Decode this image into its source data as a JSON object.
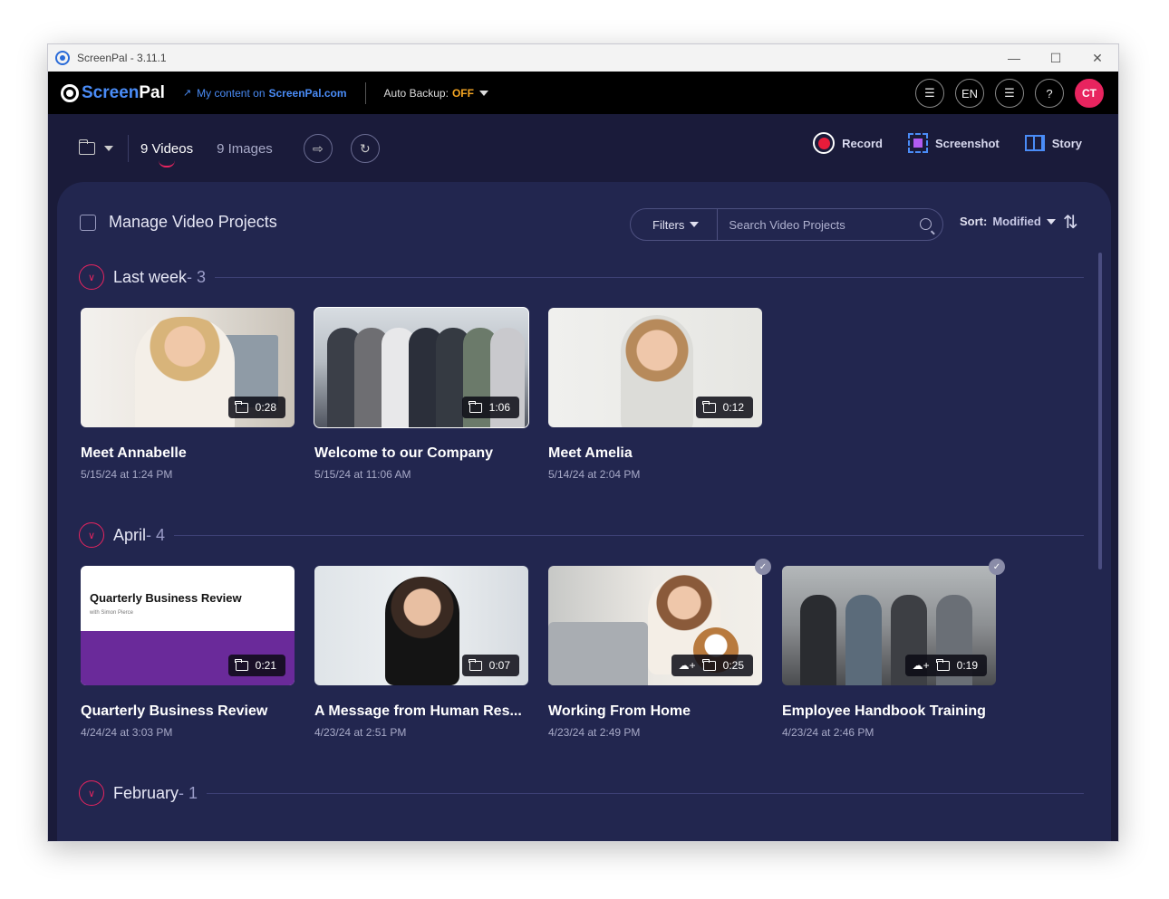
{
  "window": {
    "title": "ScreenPal - 3.11.1"
  },
  "topbar": {
    "logo_screen": "Screen",
    "logo_pal": "Pal",
    "my_content_prefix": "My content on",
    "my_content_site": "ScreenPal.com",
    "auto_backup_label": "Auto Backup:",
    "auto_backup_value": "OFF",
    "language": "EN",
    "avatar_initials": "CT"
  },
  "toolbar": {
    "tabs": [
      {
        "label": "9 Videos",
        "active": true
      },
      {
        "label": "9 Images",
        "active": false
      }
    ],
    "actions": {
      "record": "Record",
      "screenshot": "Screenshot",
      "story": "Story"
    }
  },
  "panel": {
    "manage_label": "Manage Video Projects",
    "filters_label": "Filters",
    "search_placeholder": "Search Video Projects",
    "sort_label": "Sort:",
    "sort_value": "Modified"
  },
  "sections": [
    {
      "title": "Last week",
      "count": " - 3",
      "videos": [
        {
          "title": "Meet Annabelle",
          "date": "5/15/24 at 1:24 PM",
          "duration": "0:28",
          "cloud": false,
          "checked": false
        },
        {
          "title": "Welcome to our Company",
          "date": "5/15/24 at 11:06 AM",
          "duration": "1:06",
          "cloud": false,
          "checked": false
        },
        {
          "title": "Meet Amelia",
          "date": "5/14/24 at 2:04 PM",
          "duration": "0:12",
          "cloud": false,
          "checked": false
        }
      ]
    },
    {
      "title": "April",
      "count": " - 4",
      "videos": [
        {
          "title": "Quarterly Business Review",
          "date": "4/24/24 at 3:03 PM",
          "duration": "0:21",
          "cloud": false,
          "checked": false,
          "thumb_title": "Quarterly Business Review",
          "thumb_subtitle": "with Simon Pierce"
        },
        {
          "title": "A Message from Human Res...",
          "date": "4/23/24 at 2:51 PM",
          "duration": "0:07",
          "cloud": false,
          "checked": false
        },
        {
          "title": "Working From Home",
          "date": "4/23/24 at 2:49 PM",
          "duration": "0:25",
          "cloud": true,
          "checked": true
        },
        {
          "title": "Employee Handbook Training",
          "date": "4/23/24 at 2:46 PM",
          "duration": "0:19",
          "cloud": true,
          "checked": true
        }
      ]
    },
    {
      "title": "February",
      "count": " - 1",
      "videos": []
    }
  ],
  "colors": {
    "accent": "#e8245f",
    "brand_blue": "#4a8cf7",
    "panel_bg": "#22264f",
    "app_bg": "#1a1b3a",
    "backup_off": "#f5a623"
  }
}
